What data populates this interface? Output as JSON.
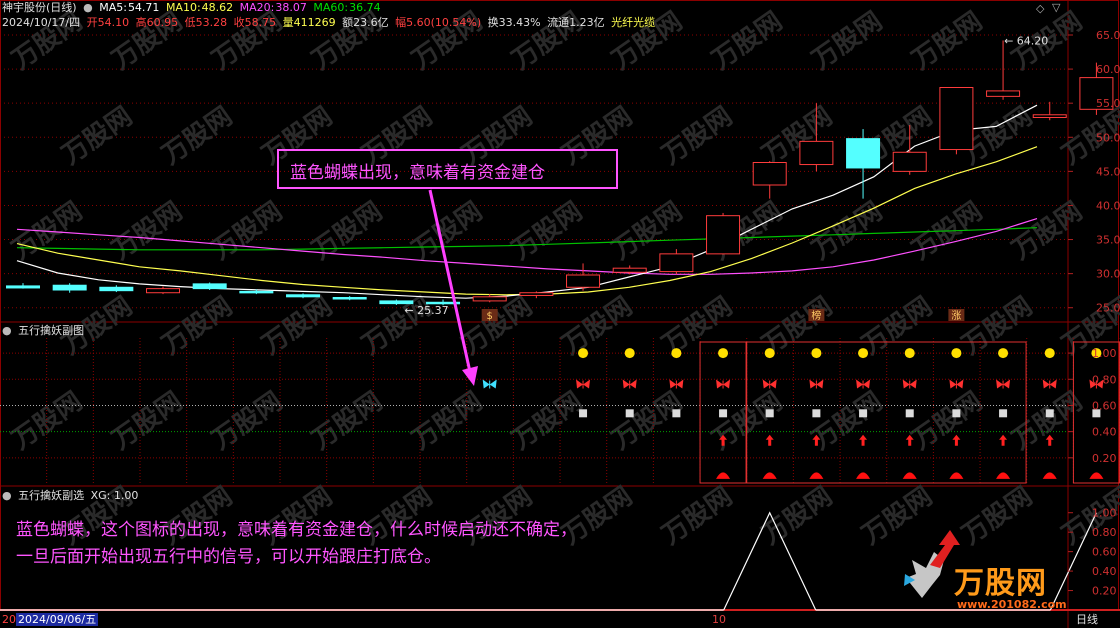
{
  "header": {
    "stock": "神宇股份(日线)",
    "ma5_label": "MA5:",
    "ma5": "54.71",
    "ma10_label": "MA10:",
    "ma10": "48.62",
    "ma20_label": "MA20:",
    "ma20": "38.07",
    "ma60_label": "MA60:",
    "ma60": "36.74",
    "date": "2024/10/17/四",
    "open": "开54.10",
    "high": "高60.95",
    "low": "低53.28",
    "close": "收58.75",
    "volume": "量411269",
    "amount": "额23.6亿",
    "change": "幅5.60(10.54%)",
    "turnover": "换33.43%",
    "float": "流通1.23亿",
    "concept": "光纤光缆"
  },
  "colors": {
    "up": "#ff3c3c",
    "down": "#54ffff",
    "ma5": "#ffffff",
    "ma10": "#ffff50",
    "ma20": "#ff50ff",
    "ma60": "#00c000",
    "accent": "#ff55ff",
    "grid": "#8b0000"
  },
  "panels": {
    "sub1_title": "五行擒妖副图",
    "sub2_title": "五行擒妖副选",
    "sub2_value": "XG: 1.00",
    "period": "日线",
    "bottom_date": "2024/09/06/五",
    "bottom_prefix": "20",
    "bottom_mark": "10"
  },
  "annotation": {
    "box_text": "蓝色蝴蝶出现，意味着有资金建仓",
    "line1": "蓝色蝴蝶，这个图标的出现，意味着有资金建仓，什么时候启动还不确定，",
    "line2": "一旦后面开始出现五行中的信号，可以开始跟庄打底仓。"
  },
  "watermark": {
    "brand": "万股网",
    "url": "www.201082.com"
  },
  "chart_data": [
    {
      "type": "candlestick",
      "y_axis_ticks": [
        "65.00",
        "60.00",
        "55.00",
        "50.00",
        "45.00",
        "40.00",
        "35.00",
        "30.00",
        "25.00"
      ],
      "ylim": [
        23.2,
        67.2
      ],
      "candles": [
        {
          "o": 28.2,
          "h": 28.6,
          "l": 27.8,
          "c": 27.9
        },
        {
          "o": 28.3,
          "h": 28.6,
          "l": 27.2,
          "c": 27.6
        },
        {
          "o": 28.0,
          "h": 28.3,
          "l": 27.3,
          "c": 27.5
        },
        {
          "o": 27.2,
          "h": 28.1,
          "l": 27.0,
          "c": 27.8
        },
        {
          "o": 28.5,
          "h": 28.7,
          "l": 27.6,
          "c": 27.8
        },
        {
          "o": 27.4,
          "h": 27.7,
          "l": 27.0,
          "c": 27.2
        },
        {
          "o": 26.9,
          "h": 27.1,
          "l": 26.4,
          "c": 26.6
        },
        {
          "o": 26.5,
          "h": 26.7,
          "l": 26.1,
          "c": 26.3
        },
        {
          "o": 26.0,
          "h": 26.2,
          "l": 25.4,
          "c": 25.6
        },
        {
          "o": 25.8,
          "h": 26.2,
          "l": 25.37,
          "c": 25.7
        },
        {
          "o": 26.0,
          "h": 27.0,
          "l": 25.8,
          "c": 26.6
        },
        {
          "o": 26.8,
          "h": 27.4,
          "l": 26.4,
          "c": 27.2
        },
        {
          "o": 28.0,
          "h": 31.5,
          "l": 27.5,
          "c": 29.8
        },
        {
          "o": 30.2,
          "h": 31.2,
          "l": 29.9,
          "c": 30.8
        },
        {
          "o": 30.3,
          "h": 33.6,
          "l": 29.9,
          "c": 32.9
        },
        {
          "o": 32.9,
          "h": 38.9,
          "l": 32.8,
          "c": 38.5
        },
        {
          "o": 43.0,
          "h": 46.5,
          "l": 41.0,
          "c": 46.3
        },
        {
          "o": 46.0,
          "h": 55.0,
          "l": 45.0,
          "c": 49.4
        },
        {
          "o": 49.8,
          "h": 51.2,
          "l": 41.0,
          "c": 45.5
        },
        {
          "o": 45.0,
          "h": 51.8,
          "l": 44.5,
          "c": 47.8
        },
        {
          "o": 48.2,
          "h": 57.3,
          "l": 47.5,
          "c": 57.3
        },
        {
          "o": 56.0,
          "h": 64.2,
          "l": 55.5,
          "c": 56.8
        },
        {
          "o": 52.9,
          "h": 55.2,
          "l": 52.5,
          "c": 53.3
        },
        {
          "o": 54.1,
          "h": 60.95,
          "l": 53.28,
          "c": 58.75
        }
      ],
      "ma5": [
        31.9,
        30.1,
        29.1,
        28.5,
        28.1,
        27.8,
        27.6,
        27.4,
        27.2,
        26.9,
        26.6,
        26.4,
        26.7,
        27.3,
        28.0,
        29.5,
        31.0,
        33.5,
        36.5,
        39.5,
        41.5,
        44.2,
        48.7,
        51.0,
        51.6,
        54.71
      ],
      "ma10": [
        34.4,
        33.0,
        32.0,
        31.0,
        30.4,
        29.7,
        29.0,
        28.4,
        28.0,
        27.6,
        27.3,
        27.0,
        26.9,
        27.0,
        27.3,
        28.0,
        29.0,
        30.3,
        32.2,
        34.5,
        37.0,
        39.6,
        42.5,
        44.6,
        46.4,
        48.62
      ],
      "ma20": [
        36.5,
        36.1,
        35.7,
        35.3,
        34.8,
        34.3,
        33.8,
        33.3,
        32.8,
        32.4,
        31.9,
        31.5,
        31.1,
        30.7,
        30.4,
        30.1,
        29.9,
        29.9,
        30.1,
        30.4,
        31.0,
        32.0,
        33.3,
        34.7,
        36.2,
        38.07
      ],
      "ma60": [
        33.8,
        33.7,
        33.6,
        33.5,
        33.5,
        33.5,
        33.5,
        33.6,
        33.7,
        33.8,
        33.9,
        34.0,
        34.1,
        34.3,
        34.5,
        34.7,
        34.9,
        35.1,
        35.3,
        35.5,
        35.7,
        35.9,
        36.1,
        36.3,
        36.5,
        36.74
      ],
      "low_label": "25.37",
      "high_label": "64.20",
      "tags": [
        {
          "index": 10,
          "text": "$"
        },
        {
          "index": 17,
          "text": "榜"
        },
        {
          "index": 20,
          "text": "涨"
        }
      ]
    },
    {
      "type": "signal_grid",
      "y_axis_ticks": [
        "1.00",
        "0.80",
        "0.60",
        "0.40",
        "0.20"
      ],
      "ylim": [
        0,
        1.1
      ],
      "butterfly_blue_index": 10,
      "signals_start_index": 12,
      "rows": {
        "sun": 1.0,
        "butterfly": 0.76,
        "square": 0.54,
        "arrow": 0.33,
        "triangle": 0.07
      },
      "full_signal_indices": [
        15,
        16,
        17,
        18,
        19,
        20,
        21,
        22,
        23
      ],
      "square_indices": [
        12,
        13,
        14,
        15,
        16,
        17,
        18,
        19,
        20,
        21,
        22,
        23
      ],
      "boxed_ranges": [
        [
          15,
          15
        ],
        [
          16,
          21
        ],
        [
          23,
          23
        ]
      ]
    },
    {
      "type": "line",
      "name": "XG",
      "y_axis_ticks": [
        "1.00",
        "0.80",
        "0.60",
        "0.40",
        "0.20"
      ],
      "ylim": [
        0,
        1.1
      ],
      "values": [
        0,
        0,
        0,
        0,
        0,
        0,
        0,
        0,
        0,
        0,
        0,
        0,
        0,
        0,
        0,
        0,
        1,
        0,
        0,
        0,
        0,
        0,
        0,
        1
      ]
    }
  ]
}
